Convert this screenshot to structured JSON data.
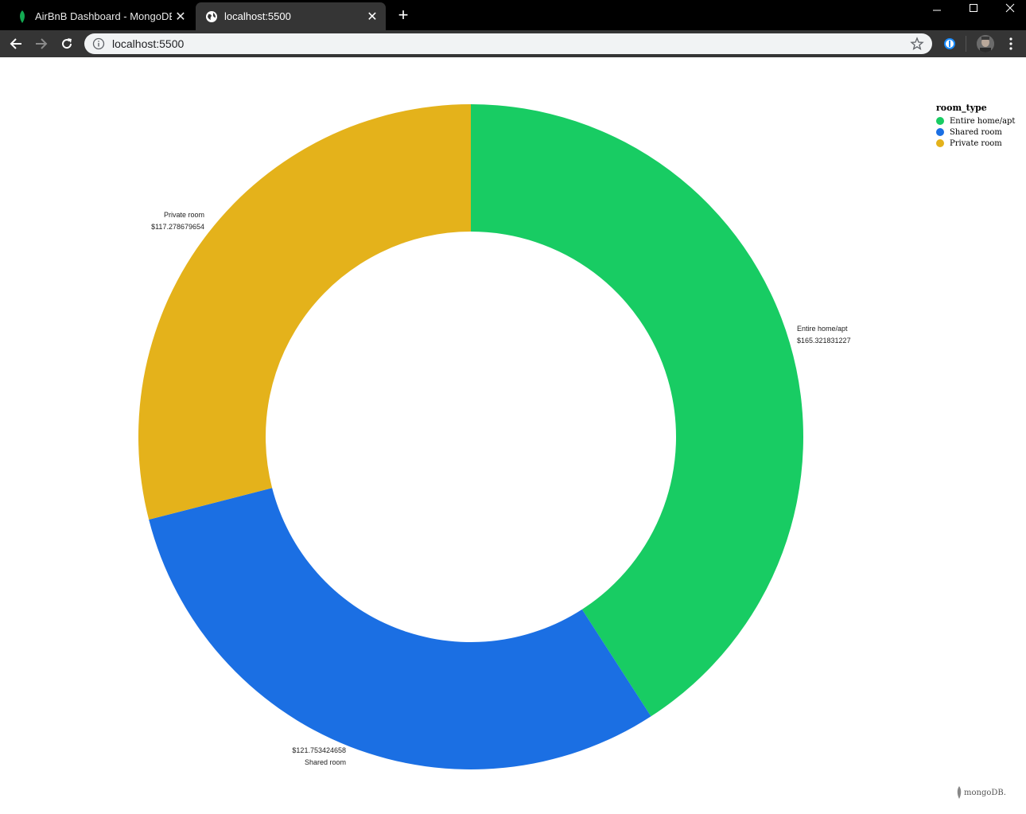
{
  "browser": {
    "tabs": [
      {
        "title": "AirBnB Dashboard - MongoDB Cl",
        "active": false
      },
      {
        "title": "localhost:5500",
        "active": true
      }
    ],
    "url": "localhost:5500"
  },
  "chart_data": {
    "type": "pie",
    "donut": true,
    "legend_title": "room_type",
    "legend_position": "top-right",
    "categories": [
      "Entire home/apt",
      "Shared room",
      "Private room"
    ],
    "values": [
      165.321831227,
      121.753424658,
      117.278679654
    ],
    "value_labels": [
      "$165.321831227",
      "$121.753424658",
      "$117.278679654"
    ],
    "colors": [
      "#18cc63",
      "#1b6fe3",
      "#e4b21b"
    ]
  },
  "footer": {
    "logo_text": "mongoDB."
  }
}
